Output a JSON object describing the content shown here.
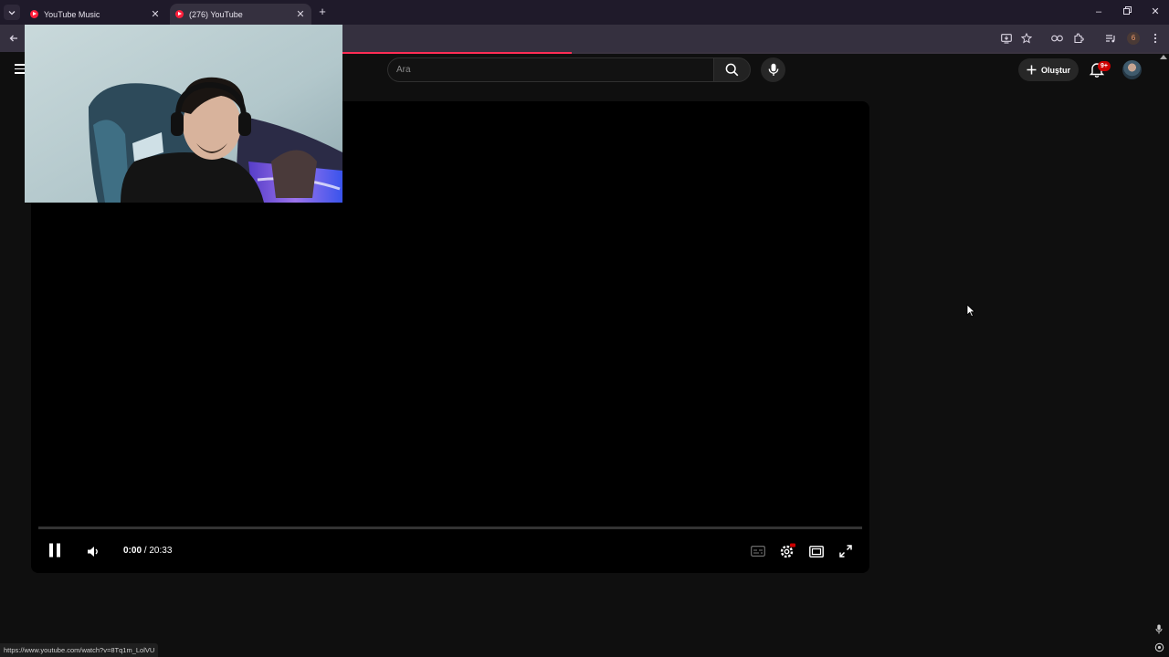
{
  "browser": {
    "tabs": [
      {
        "title": "YouTube Music",
        "active": false
      },
      {
        "title": "(276) YouTube",
        "active": true
      }
    ],
    "extension_badge": "6",
    "status_url": "https://www.youtube.com/watch?v=8Tq1m_LolVU",
    "accent_color": "#ff2d55"
  },
  "youtube": {
    "search": {
      "placeholder": "Ara",
      "value": ""
    },
    "create_label": "Oluştur",
    "notifications_badge": "9+"
  },
  "player": {
    "current_time": "0:00",
    "separator": "/",
    "duration": "20:33",
    "state": "playing",
    "progress_fraction": 0.0,
    "settings_badge_color": "#cc0000"
  },
  "icons": [
    "tab-search-icon",
    "close-icon",
    "new-tab-icon",
    "minimize-icon",
    "restore-icon",
    "back-icon",
    "install-icon",
    "bookmark-star-icon",
    "extension-icon",
    "puzzle-icon",
    "media-control-icon",
    "kebab-menu-icon",
    "hamburger-menu-icon",
    "search-icon",
    "mic-icon",
    "plus-icon",
    "bell-icon",
    "pause-icon",
    "volume-icon",
    "subtitles-icon",
    "settings-gear-icon",
    "theater-mode-icon",
    "fullscreen-icon",
    "mouse-cursor-icon"
  ]
}
